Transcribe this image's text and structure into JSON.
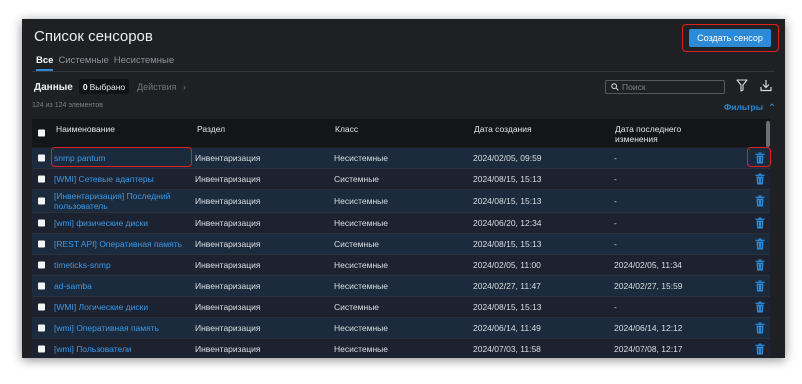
{
  "header": {
    "title": "Список сенсоров",
    "create_label": "Создать сенсор"
  },
  "tabs": [
    {
      "label": "Все",
      "active": true
    },
    {
      "label": "Системные",
      "active": false
    },
    {
      "label": "Несистемные",
      "active": false
    }
  ],
  "toolbar": {
    "data_label": "Данные",
    "selected_count": "0",
    "selected_label": "Выбрано",
    "actions_label": "Действия",
    "actions_chevron": "›",
    "search_placeholder": "Поиск",
    "count_text": "124 из 124 элементов",
    "filters_label": "Фильтры",
    "filters_chevron": "⌃"
  },
  "table": {
    "columns": [
      "Наименование",
      "Раздел",
      "Класс",
      "Дата создания",
      "Дата последнего изменения"
    ],
    "rows": [
      {
        "name": "snmp pantum",
        "section": "Инвентаризация",
        "class": "Несистемные",
        "created": "2024/02/05, 09:59",
        "modified": "-"
      },
      {
        "name": "[WMI] Сетевые адаптеры",
        "section": "Инвентаризация",
        "class": "Системные",
        "created": "2024/08/15, 15:13",
        "modified": "-"
      },
      {
        "name": "[Инвентаризация] Последний пользователь",
        "section": "Инвентаризация",
        "class": "Несистемные",
        "created": "2024/08/15, 15:13",
        "modified": "-"
      },
      {
        "name": "[wmi] физические диски",
        "section": "Инвентаризация",
        "class": "Несистемные",
        "created": "2024/06/20, 12:34",
        "modified": "-"
      },
      {
        "name": "[REST API] Оперативная память",
        "section": "Инвентаризация",
        "class": "Системные",
        "created": "2024/08/15, 15:13",
        "modified": "-"
      },
      {
        "name": "timeticks-snmp",
        "section": "Инвентаризация",
        "class": "Несистемные",
        "created": "2024/02/05, 11:00",
        "modified": "2024/02/05, 11:34"
      },
      {
        "name": "ad-samba",
        "section": "Инвентаризация",
        "class": "Несистемные",
        "created": "2024/02/27, 11:47",
        "modified": "2024/02/27, 15:59"
      },
      {
        "name": "[WMI] Логические диски",
        "section": "Инвентаризация",
        "class": "Системные",
        "created": "2024/08/15, 15:13",
        "modified": "-"
      },
      {
        "name": "[wmi] Оперативная память",
        "section": "Инвентаризация",
        "class": "Несистемные",
        "created": "2024/06/14, 11:49",
        "modified": "2024/06/14, 12:12"
      },
      {
        "name": "[wmi] Пользователи",
        "section": "Инвентаризация",
        "class": "Несистемные",
        "created": "2024/07/03, 11:58",
        "modified": "2024/07/08, 12:17"
      }
    ]
  },
  "colors": {
    "accent": "#2d8ad6",
    "highlight": "#e02020",
    "background": "#1f2023"
  }
}
